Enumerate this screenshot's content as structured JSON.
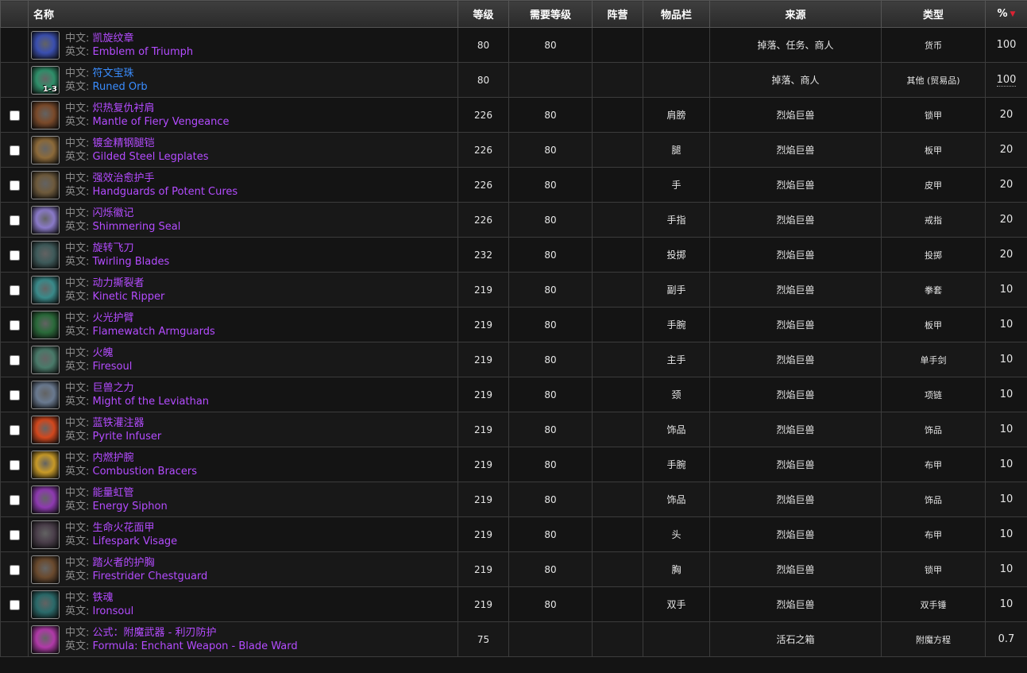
{
  "columns": {
    "name": "名称",
    "level": "等级",
    "req_level": "需要等级",
    "faction": "阵营",
    "slot": "物品栏",
    "source": "来源",
    "type": "类型",
    "pct": "%"
  },
  "labels": {
    "cn": "中文:",
    "en": "英文:"
  },
  "rows": [
    {
      "cn": "凯旋纹章",
      "en": "Emblem of Triumph",
      "level": "80",
      "req": "80",
      "slot": "",
      "source": "掉落、任务、商人",
      "type": "货币",
      "pct": "100",
      "quality": "epic",
      "checkbox": false,
      "qty": "",
      "icon": "emblem-icon",
      "color": "#3a4fb0"
    },
    {
      "cn": "符文宝珠",
      "en": "Runed Orb",
      "level": "80",
      "req": "",
      "slot": "",
      "source": "掉落、商人",
      "type": "其他 (贸易品)",
      "pct": "100",
      "quality": "rare",
      "checkbox": false,
      "qty": "1-3",
      "icon": "orb-icon",
      "color": "#2f8f6a"
    },
    {
      "cn": "炽热复仇衬肩",
      "en": "Mantle of Fiery Vengeance",
      "level": "226",
      "req": "80",
      "slot": "肩膀",
      "source": "烈焰巨兽",
      "type": "锁甲",
      "pct": "20",
      "quality": "epic",
      "checkbox": true,
      "qty": "",
      "icon": "shoulder-icon",
      "color": "#7a4a2a"
    },
    {
      "cn": "镀金精钢腿铠",
      "en": "Gilded Steel Legplates",
      "level": "226",
      "req": "80",
      "slot": "腿",
      "source": "烈焰巨兽",
      "type": "板甲",
      "pct": "20",
      "quality": "epic",
      "checkbox": true,
      "qty": "",
      "icon": "legplates-icon",
      "color": "#8c6a3a"
    },
    {
      "cn": "强效治愈护手",
      "en": "Handguards of Potent Cures",
      "level": "226",
      "req": "80",
      "slot": "手",
      "source": "烈焰巨兽",
      "type": "皮甲",
      "pct": "20",
      "quality": "epic",
      "checkbox": true,
      "qty": "",
      "icon": "gloves-icon",
      "color": "#6e5a3c"
    },
    {
      "cn": "闪烁徽记",
      "en": "Shimmering Seal",
      "level": "226",
      "req": "80",
      "slot": "手指",
      "source": "烈焰巨兽",
      "type": "戒指",
      "pct": "20",
      "quality": "epic",
      "checkbox": true,
      "qty": "",
      "icon": "ring-icon",
      "color": "#8a7ac8"
    },
    {
      "cn": "旋转飞刀",
      "en": "Twirling Blades",
      "level": "232",
      "req": "80",
      "slot": "投掷",
      "source": "烈焰巨兽",
      "type": "投掷",
      "pct": "20",
      "quality": "epic",
      "checkbox": true,
      "qty": "",
      "icon": "blades-icon",
      "color": "#3e5a5a"
    },
    {
      "cn": "动力撕裂者",
      "en": "Kinetic Ripper",
      "level": "219",
      "req": "80",
      "slot": "副手",
      "source": "烈焰巨兽",
      "type": "拳套",
      "pct": "10",
      "quality": "epic",
      "checkbox": true,
      "qty": "",
      "icon": "fist-icon",
      "color": "#3a8a8a"
    },
    {
      "cn": "火光护臂",
      "en": "Flamewatch Armguards",
      "level": "219",
      "req": "80",
      "slot": "手腕",
      "source": "烈焰巨兽",
      "type": "板甲",
      "pct": "10",
      "quality": "epic",
      "checkbox": true,
      "qty": "",
      "icon": "armguards-icon",
      "color": "#2a6a3a"
    },
    {
      "cn": "火魄",
      "en": "Firesoul",
      "level": "219",
      "req": "80",
      "slot": "主手",
      "source": "烈焰巨兽",
      "type": "单手剑",
      "pct": "10",
      "quality": "epic",
      "checkbox": true,
      "qty": "",
      "icon": "sword-icon",
      "color": "#4a7a6a"
    },
    {
      "cn": "巨兽之力",
      "en": "Might of the Leviathan",
      "level": "219",
      "req": "80",
      "slot": "颈",
      "source": "烈焰巨兽",
      "type": "项链",
      "pct": "10",
      "quality": "epic",
      "checkbox": true,
      "qty": "",
      "icon": "necklace-icon",
      "color": "#6a7a90"
    },
    {
      "cn": "蓝铁灌注器",
      "en": "Pyrite Infuser",
      "level": "219",
      "req": "80",
      "slot": "饰品",
      "source": "烈焰巨兽",
      "type": "饰品",
      "pct": "10",
      "quality": "epic",
      "checkbox": true,
      "qty": "",
      "icon": "infuser-icon",
      "color": "#d2481e"
    },
    {
      "cn": "内燃护腕",
      "en": "Combustion Bracers",
      "level": "219",
      "req": "80",
      "slot": "手腕",
      "source": "烈焰巨兽",
      "type": "布甲",
      "pct": "10",
      "quality": "epic",
      "checkbox": true,
      "qty": "",
      "icon": "bracers-icon",
      "color": "#c89a28"
    },
    {
      "cn": "能量虹管",
      "en": "Energy Siphon",
      "level": "219",
      "req": "80",
      "slot": "饰品",
      "source": "烈焰巨兽",
      "type": "饰品",
      "pct": "10",
      "quality": "epic",
      "checkbox": true,
      "qty": "",
      "icon": "siphon-icon",
      "color": "#8e3ab0"
    },
    {
      "cn": "生命火花面甲",
      "en": "Lifespark Visage",
      "level": "219",
      "req": "80",
      "slot": "头",
      "source": "烈焰巨兽",
      "type": "布甲",
      "pct": "10",
      "quality": "epic",
      "checkbox": true,
      "qty": "",
      "icon": "hood-icon",
      "color": "#4a3e4a"
    },
    {
      "cn": "踏火者的护胸",
      "en": "Firestrider Chestguard",
      "level": "219",
      "req": "80",
      "slot": "胸",
      "source": "烈焰巨兽",
      "type": "锁甲",
      "pct": "10",
      "quality": "epic",
      "checkbox": true,
      "qty": "",
      "icon": "chest-icon",
      "color": "#6a4a2e"
    },
    {
      "cn": "铁魂",
      "en": "Ironsoul",
      "level": "219",
      "req": "80",
      "slot": "双手",
      "source": "烈焰巨兽",
      "type": "双手锤",
      "pct": "10",
      "quality": "epic",
      "checkbox": true,
      "qty": "",
      "icon": "mace-icon",
      "color": "#2a6a6a"
    },
    {
      "cn": "公式：附魔武器 - 利刃防护",
      "en": "Formula: Enchant Weapon - Blade Ward",
      "level": "75",
      "req": "",
      "slot": "",
      "source": "活石之箱",
      "type": "附魔方程",
      "pct": "0.7",
      "quality": "epic",
      "checkbox": false,
      "qty": "",
      "icon": "formula-icon",
      "color": "#b03aa8"
    }
  ]
}
